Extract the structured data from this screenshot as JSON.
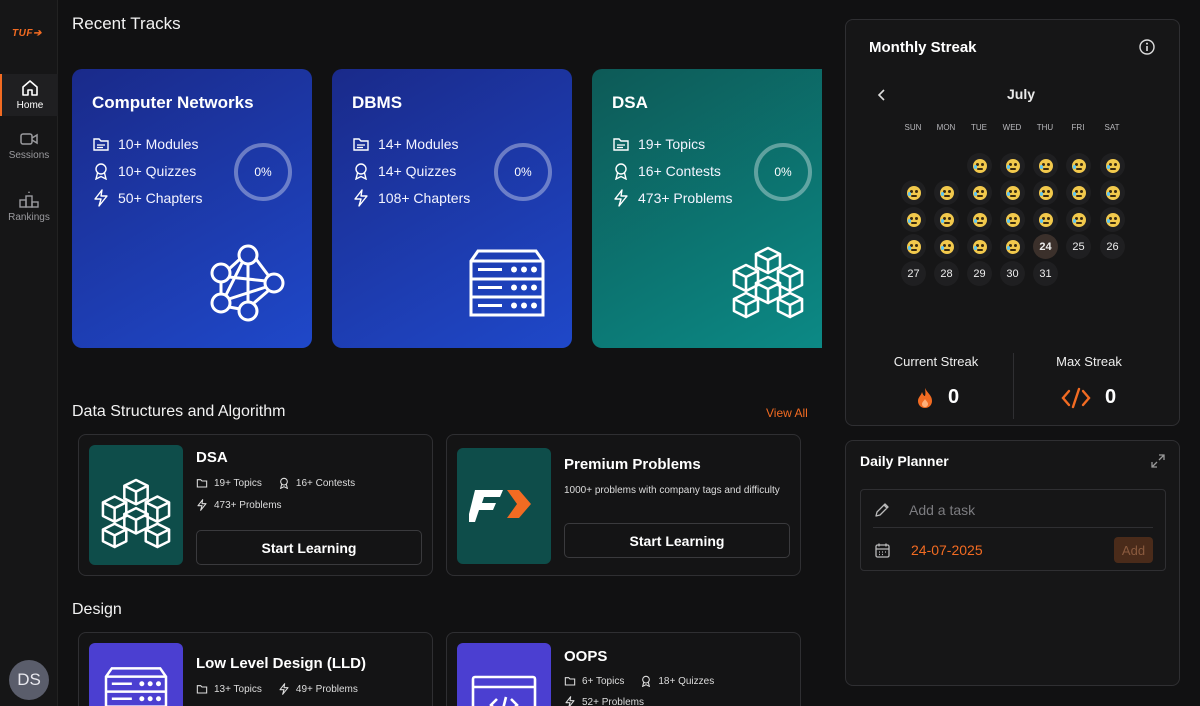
{
  "sidebar": {
    "logo": "TUF",
    "items": [
      {
        "label": "Home",
        "active": true,
        "icon": "home-icon"
      },
      {
        "label": "Sessions",
        "active": false,
        "icon": "video-icon"
      },
      {
        "label": "Rankings",
        "active": false,
        "icon": "podium-icon"
      }
    ],
    "avatar_initials": "DS"
  },
  "recent_tracks": {
    "heading": "Recent Tracks",
    "cards": [
      {
        "title": "Computer Networks",
        "stats": [
          {
            "icon": "folder-icon",
            "text": "10+  Modules"
          },
          {
            "icon": "badge-icon",
            "text": "10+  Quizzes"
          },
          {
            "icon": "bolt-icon",
            "text": "50+  Chapters"
          }
        ],
        "progress": "0%",
        "art": "network-icon",
        "color_from": "#1a2a8a",
        "color_to": "#1f48c9"
      },
      {
        "title": "DBMS",
        "stats": [
          {
            "icon": "folder-icon",
            "text": "14+  Modules"
          },
          {
            "icon": "badge-icon",
            "text": "14+  Quizzes"
          },
          {
            "icon": "bolt-icon",
            "text": "108+  Chapters"
          }
        ],
        "progress": "0%",
        "art": "server-icon",
        "color_from": "#1a2a8a",
        "color_to": "#1f48c9"
      },
      {
        "title": "DSA",
        "stats": [
          {
            "icon": "folder-icon",
            "text": "19+  Topics"
          },
          {
            "icon": "badge-icon",
            "text": "16+  Contests"
          },
          {
            "icon": "bolt-icon",
            "text": "473+  Problems"
          }
        ],
        "progress": "0%",
        "art": "cubes-icon",
        "color_from": "#0d5a57",
        "color_to": "#0c8a86"
      }
    ]
  },
  "dsa_section": {
    "heading": "Data Structures and Algorithm",
    "view_all": "View All",
    "cards": [
      {
        "title": "DSA",
        "meta1": "19+ Topics",
        "meta2": "16+ Contests",
        "meta3": "473+ Problems",
        "button": "Start Learning"
      },
      {
        "title": "Premium Problems",
        "desc": "1000+ problems with company tags and difficulty",
        "button": "Start Learning"
      }
    ]
  },
  "design_section": {
    "heading": "Design",
    "cards": [
      {
        "title": "Low Level Design (LLD)",
        "meta1": "13+ Topics",
        "meta2": "49+ Problems"
      },
      {
        "title": "OOPS",
        "meta1": "6+ Topics",
        "meta2": "18+ Quizzes",
        "meta3": "52+ Problems"
      }
    ]
  },
  "streak": {
    "title": "Monthly Streak",
    "month": "July",
    "weekdays": [
      "SUN",
      "MON",
      "TUE",
      "WED",
      "THU",
      "FRI",
      "SAT"
    ],
    "days": [
      "24",
      "25",
      "26",
      "27",
      "28",
      "29",
      "30",
      "31"
    ],
    "today": "24",
    "current_label": "Current Streak",
    "current_value": "0",
    "max_label": "Max Streak",
    "max_value": "0"
  },
  "planner": {
    "title": "Daily Planner",
    "placeholder": "Add a task",
    "date": "24-07-2025",
    "add_label": "Add"
  },
  "colors": {
    "accent": "#f26b22"
  }
}
